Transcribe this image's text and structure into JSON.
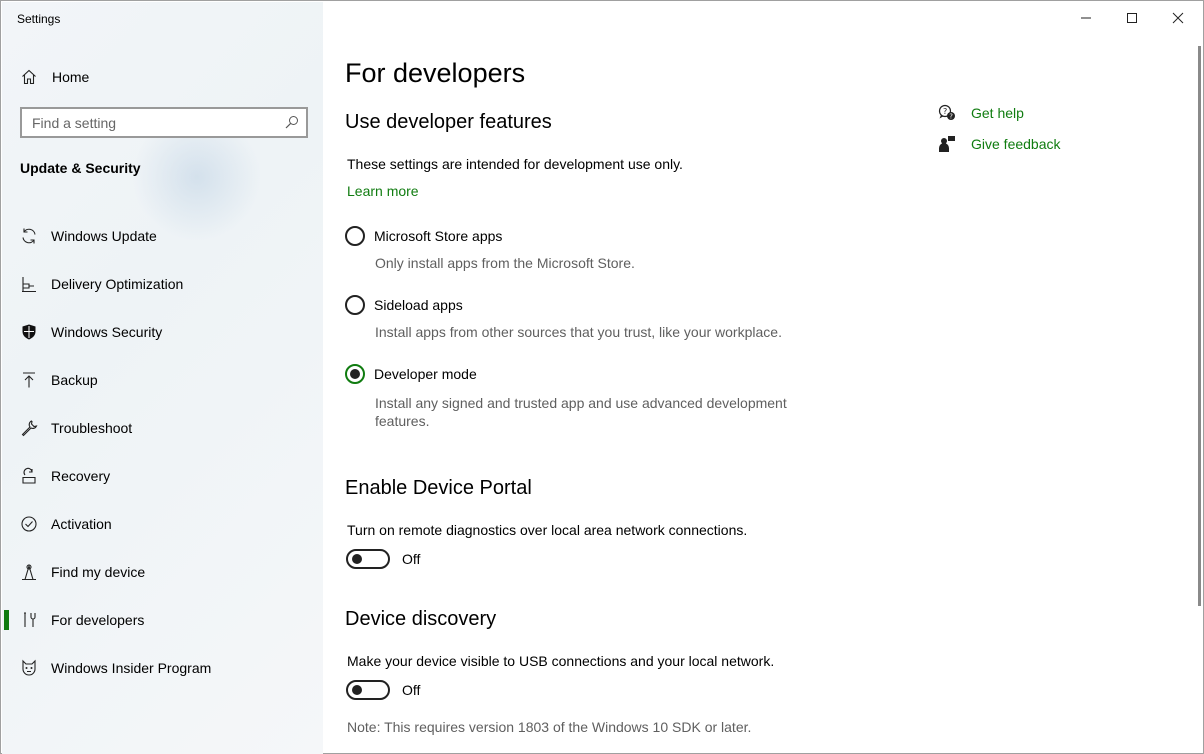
{
  "window": {
    "title": "Settings"
  },
  "sidebar": {
    "home_label": "Home",
    "search_placeholder": "Find a setting",
    "section_heading": "Update & Security",
    "items": [
      {
        "label": "Windows Update",
        "icon": "sync-icon",
        "active": false
      },
      {
        "label": "Delivery Optimization",
        "icon": "delivery-optimization-icon",
        "active": false
      },
      {
        "label": "Windows Security",
        "icon": "shield-icon",
        "active": false
      },
      {
        "label": "Backup",
        "icon": "backup-arrow-icon",
        "active": false
      },
      {
        "label": "Troubleshoot",
        "icon": "wrench-icon",
        "active": false
      },
      {
        "label": "Recovery",
        "icon": "recovery-icon",
        "active": false
      },
      {
        "label": "Activation",
        "icon": "check-circle-icon",
        "active": false
      },
      {
        "label": "Find my device",
        "icon": "find-device-icon",
        "active": false
      },
      {
        "label": "For developers",
        "icon": "developer-tools-icon",
        "active": true
      },
      {
        "label": "Windows Insider Program",
        "icon": "insider-cat-icon",
        "active": false
      }
    ]
  },
  "main": {
    "page_title": "For developers",
    "dev_features": {
      "heading": "Use developer features",
      "description": "These settings are intended for development use only.",
      "learn_more": "Learn more",
      "options": [
        {
          "label": "Microsoft Store apps",
          "description": "Only install apps from the Microsoft Store.",
          "checked": false
        },
        {
          "label": "Sideload apps",
          "description": "Install apps from other sources that you trust, like your workplace.",
          "checked": false
        },
        {
          "label": "Developer mode",
          "description": "Install any signed and trusted app and use advanced development features.",
          "checked": true
        }
      ]
    },
    "device_portal": {
      "heading": "Enable Device Portal",
      "description": "Turn on remote diagnostics over local area network connections.",
      "toggle_state": "Off"
    },
    "device_discovery": {
      "heading": "Device discovery",
      "description": "Make your device visible to USB connections and your local network.",
      "toggle_state": "Off",
      "note": "Note: This requires version 1803 of the Windows 10 SDK or later."
    }
  },
  "help": {
    "get_help": "Get help",
    "give_feedback": "Give feedback"
  },
  "colors": {
    "accent": "#107c10",
    "sidebar_bg": "#f2f5f8",
    "muted_text": "#5f5f5f"
  }
}
